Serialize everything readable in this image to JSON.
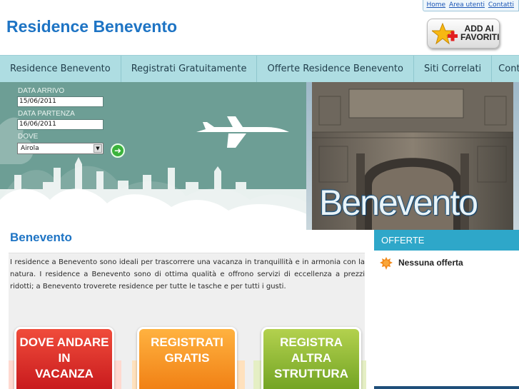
{
  "header": {
    "top_links": [
      "Home",
      "Area utenti",
      "Contatti"
    ],
    "site_title": "Residence Benevento",
    "favorites_button": {
      "line1": "ADD AI",
      "line2": "FAVORITI"
    }
  },
  "nav": {
    "items": [
      "Residence Benevento",
      "Registrati Gratuitamente",
      "Offerte Residence Benevento",
      "Siti Correlati",
      "Contattaci"
    ]
  },
  "search": {
    "arrival_label": "DATA ARRIVO",
    "arrival_value": "15/06/2011",
    "departure_label": "DATA PARTENZA",
    "departure_value": "16/06/2011",
    "where_label": "DOVE",
    "where_value": "Airola"
  },
  "photo": {
    "caption": "Benevento"
  },
  "main": {
    "title": "Benevento",
    "intro": "I residence a Benevento sono ideali per trascorrere una vacanza in tranquillità e in armonia con la natura. I residence a Benevento sono di ottima qualità e offrono servizi di eccellenza a prezzi ridotti; a Benevento troverete residence per tutte le tasche e per tutti i gusti.",
    "promos": [
      {
        "lines": [
          "DOVE ANDARE",
          "IN",
          "VACANZA"
        ],
        "color": "#d9261f"
      },
      {
        "lines": [
          "REGISTRATI",
          "GRATIS"
        ],
        "color": "#f39116"
      },
      {
        "lines": [
          "REGISTRA",
          "ALTRA",
          "STRUTTURA"
        ],
        "color": "#8ab52f"
      }
    ]
  },
  "sidebar": {
    "heading": "OFFERTE",
    "offer_text": "Nessuna offerta"
  },
  "colors": {
    "accent": "#1e74c4",
    "nav_bg": "#aedde2",
    "sidebar_head": "#2ea7c9",
    "banner_bg": "#6d9e95"
  }
}
